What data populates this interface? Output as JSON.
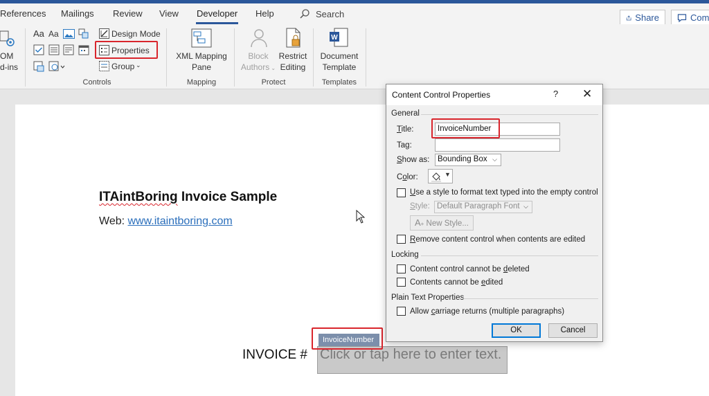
{
  "menubar": {
    "tabs": [
      "References",
      "Mailings",
      "Review",
      "View",
      "Developer",
      "Help"
    ],
    "active_tab": "Developer",
    "search_label": "Search",
    "share_label": "Share",
    "comments_label": "Comr"
  },
  "ribbon": {
    "addins": {
      "line1": "OM",
      "line2": "d-ins"
    },
    "controls": {
      "design_mode": "Design Mode",
      "properties": "Properties",
      "group": "Group",
      "label": "Controls"
    },
    "mapping": {
      "line1": "XML Mapping",
      "line2": "Pane",
      "label": "Mapping"
    },
    "protect": {
      "block_line1": "Block",
      "block_line2": "Authors",
      "restrict_line1": "Restrict",
      "restrict_line2": "Editing",
      "label": "Protect"
    },
    "templates": {
      "line1": "Document",
      "line2": "Template",
      "label": "Templates"
    }
  },
  "document": {
    "heading_part1": "ITAintBoring",
    "heading_part2": " Invoice Sample",
    "web_label": "Web: ",
    "web_link": "www.itaintboring.com",
    "invoice_label": "INVOICE #",
    "cc_tag": "InvoiceNumber",
    "cc_placeholder": "Click or tap here to enter text."
  },
  "dialog": {
    "title": "Content Control Properties",
    "help": "?",
    "close": "✕",
    "general": "General",
    "title_label_u": "T",
    "title_label_rest": "itle:",
    "title_value": "InvoiceNumber",
    "tag_label_pre": "Ta",
    "tag_label_u": "g",
    "tag_label_post": ":",
    "tag_value": "",
    "showas_label_u": "S",
    "showas_label_rest": "how as:",
    "showas_value": "Bounding Box",
    "color_label_pre": "C",
    "color_label_u": "o",
    "color_label_post": "lor:",
    "use_style_u": "U",
    "use_style_rest": "se a style to format text typed into the empty control",
    "style_label_u": "S",
    "style_label_rest": "tyle:",
    "style_value": "Default Paragraph Font",
    "new_style": "New Style...",
    "remove_u": "R",
    "remove_rest": "emove content control when contents are edited",
    "locking": "Locking",
    "lock_delete_pre": "Content control cannot be ",
    "lock_delete_u": "d",
    "lock_delete_post": "eleted",
    "lock_edit_pre": "Contents cannot be ",
    "lock_edit_u": "e",
    "lock_edit_post": "dited",
    "plain_text": "Plain Text Properties",
    "allow_pre": "Allow ",
    "allow_u": "c",
    "allow_post": "arriage returns (multiple paragraphs)",
    "ok": "OK",
    "cancel": "Cancel"
  },
  "colors": {
    "accent": "#2b579a",
    "highlight_box": "#d9252c",
    "link": "#2a6ebb",
    "cc_tag_bg": "#7c8fab"
  }
}
